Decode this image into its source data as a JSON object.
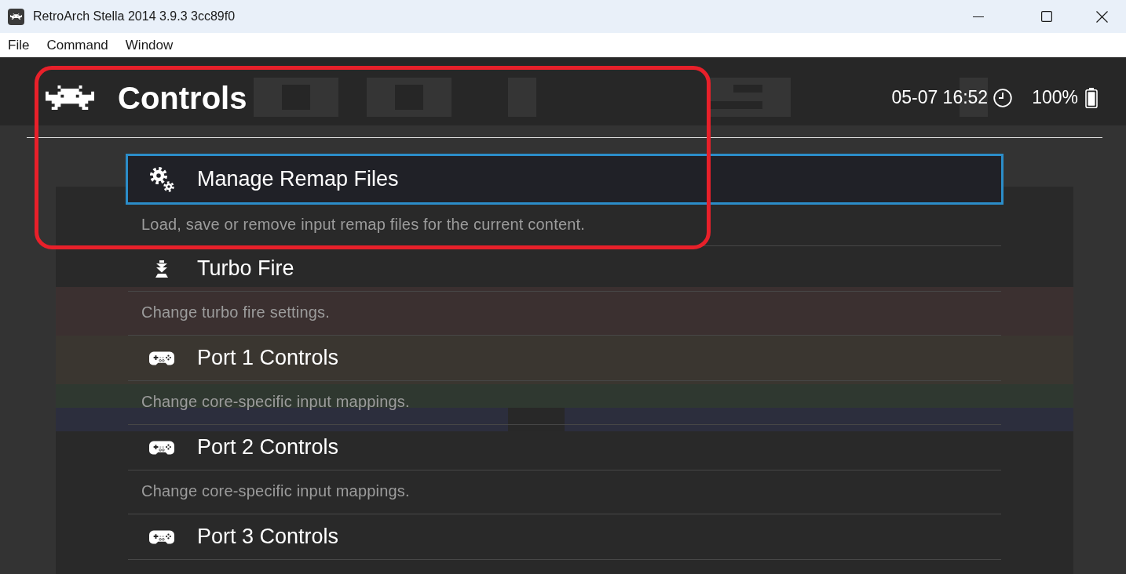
{
  "window": {
    "title": "RetroArch Stella 2014 3.9.3 3cc89f0"
  },
  "menu_bar": [
    {
      "label": "File"
    },
    {
      "label": "Command"
    },
    {
      "label": "Window"
    }
  ],
  "header": {
    "title": "Controls",
    "clock": "05-07 16:52",
    "battery": "100%"
  },
  "entries": [
    {
      "kind": "remap",
      "label": "Manage Remap Files",
      "sublabel": "Load, save or remove input remap files for the current content.",
      "selected": true
    },
    {
      "kind": "turbo",
      "label": "Turbo Fire",
      "sublabel": "Change turbo fire settings.",
      "selected": false
    },
    {
      "kind": "port",
      "label": "Port 1 Controls",
      "sublabel": "Change core-specific input mappings.",
      "selected": false
    },
    {
      "kind": "port",
      "label": "Port 2 Controls",
      "sublabel": "Change core-specific input mappings.",
      "selected": false
    },
    {
      "kind": "port",
      "label": "Port 3 Controls",
      "selected": false
    }
  ]
}
